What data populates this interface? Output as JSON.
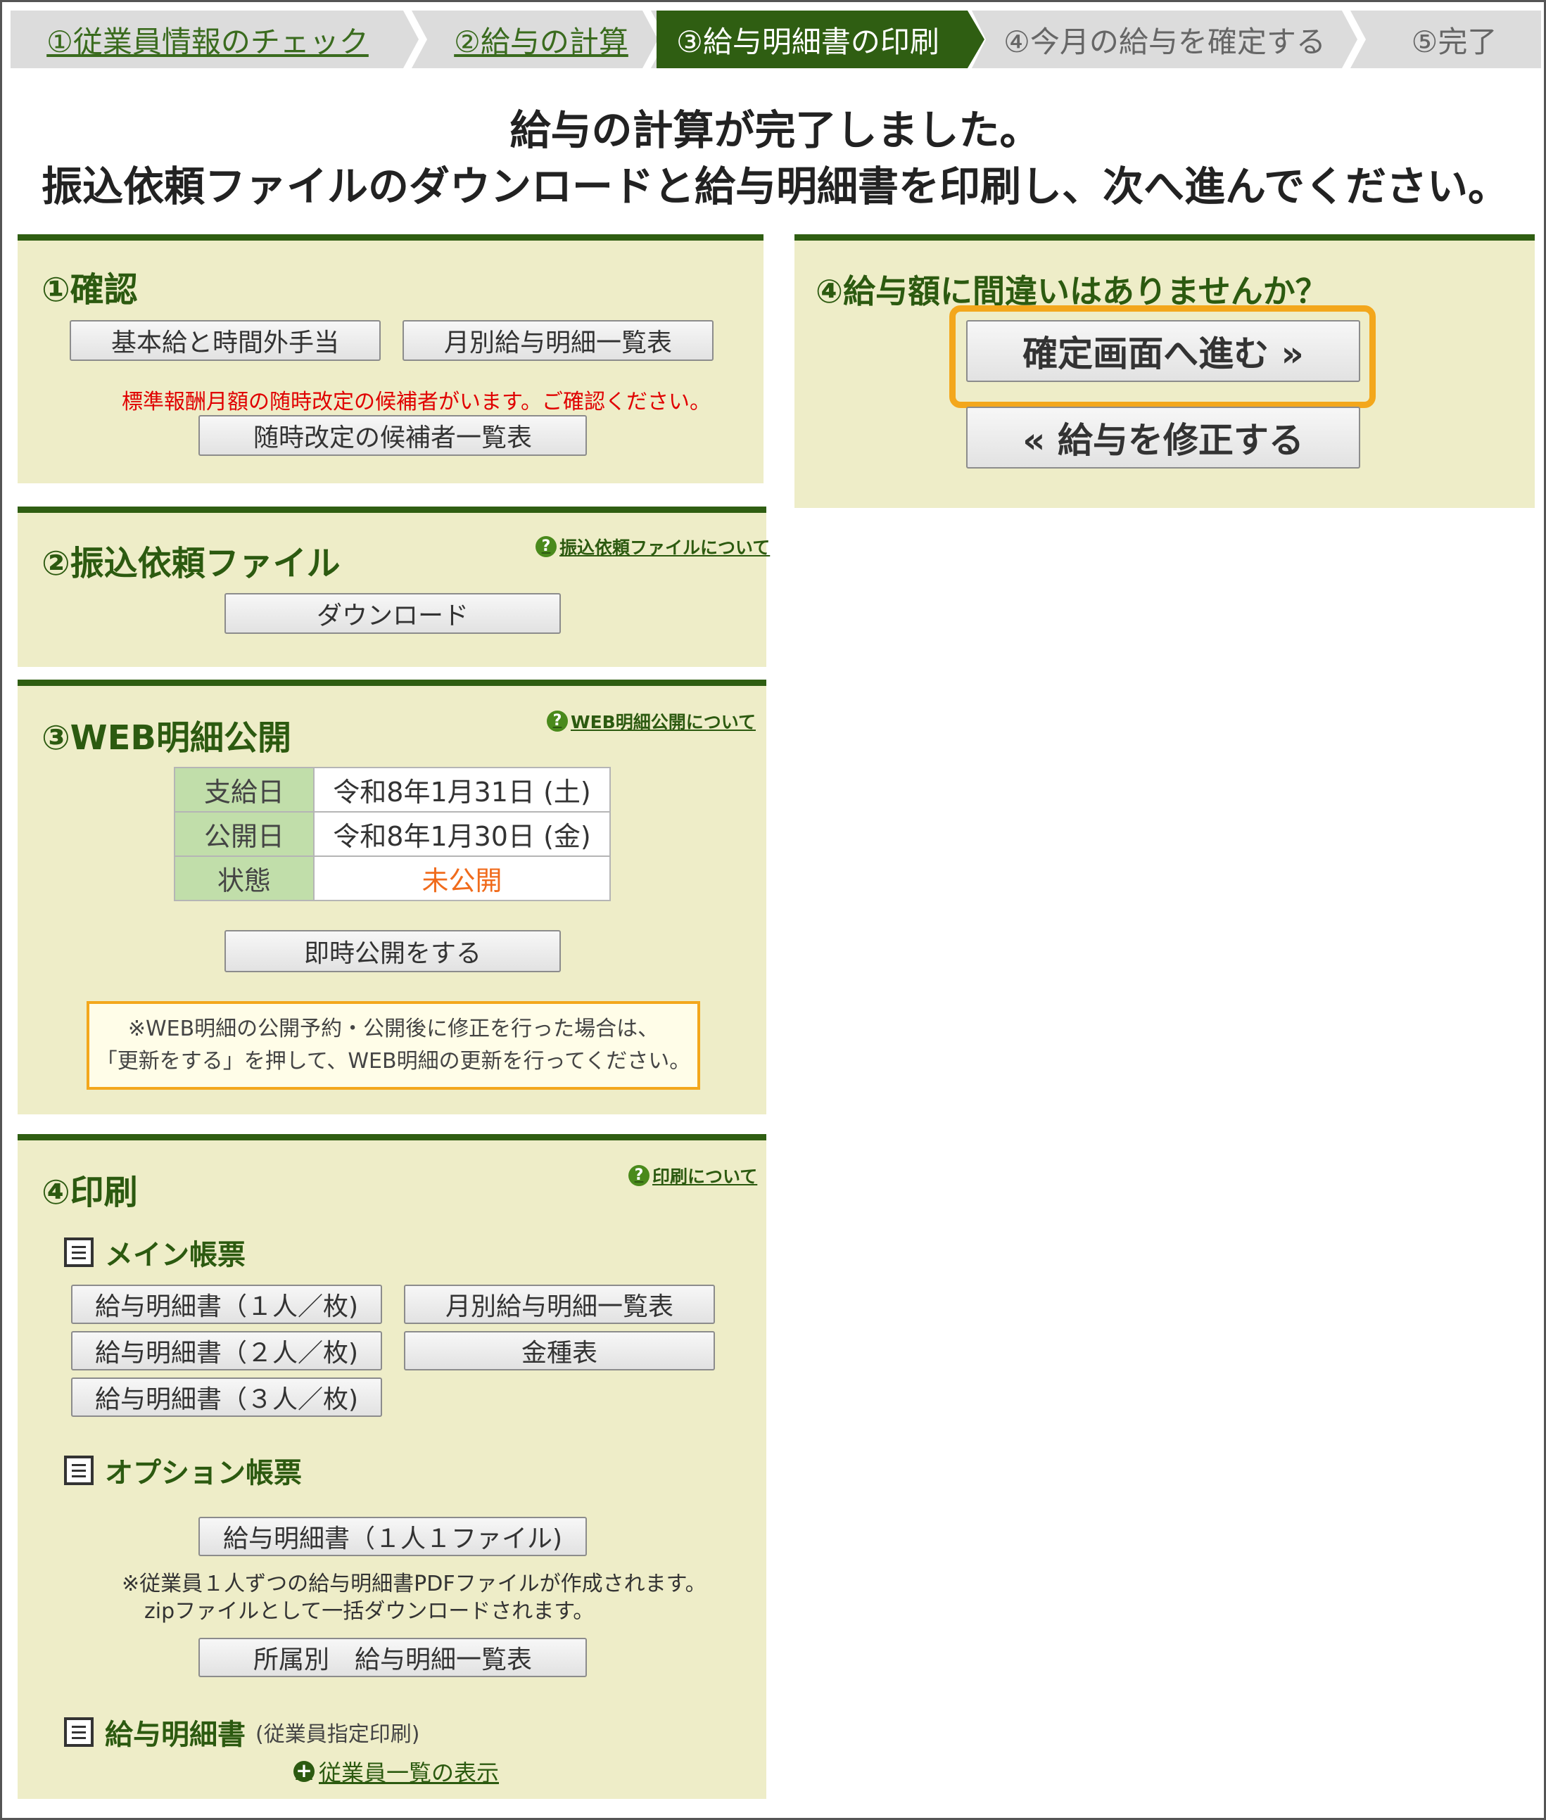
{
  "steps": [
    {
      "label": "①従業員情報のチェック",
      "state": "done"
    },
    {
      "label": "②給与の計算",
      "state": "done"
    },
    {
      "label": "③給与明細書の印刷",
      "state": "active"
    },
    {
      "label": "④今月の給与を確定する",
      "state": "future"
    },
    {
      "label": "⑤完了",
      "state": "future"
    }
  ],
  "heading": {
    "line1": "給与の計算が完了しました。",
    "line2": "振込依頼ファイルのダウンロードと給与明細書を印刷し、次へ進んでください。"
  },
  "confirm": {
    "title": "①確認",
    "btn_basic": "基本給と時間外手当",
    "btn_monthly": "月別給与明細一覧表",
    "warning": "標準報酬月額の随時改定の候補者がいます。ご確認ください。",
    "btn_candidates": "随時改定の候補者一覧表"
  },
  "transfer": {
    "title": "②振込依頼ファイル",
    "help": "振込依頼ファイルについて",
    "btn_download": "ダウンロード"
  },
  "web": {
    "title": "③WEB明細公開",
    "help": "WEB明細公開について",
    "rows": [
      {
        "key": "支給日",
        "value": "令和8年1月31日 (土)"
      },
      {
        "key": "公開日",
        "value": "令和8年1月30日 (金)"
      },
      {
        "key": "状態",
        "value": "未公開"
      }
    ],
    "btn_publish": "即時公開をする",
    "note_line1": "※WEB明細の公開予約・公開後に修正を行った場合は、",
    "note_line2": "「更新をする」を押して、WEB明細の更新を行ってください。"
  },
  "print": {
    "title": "④印刷",
    "help": "印刷について",
    "main_title": "メイン帳票",
    "btn_slip1": "給与明細書（１人／枚)",
    "btn_monthly": "月別給与明細一覧表",
    "btn_slip2": "給与明細書（２人／枚)",
    "btn_denom": "金種表",
    "btn_slip3": "給与明細書（３人／枚)",
    "option_title": "オプション帳票",
    "btn_slip_file": "給与明細書（１人１ファイル)",
    "option_note1": "※従業員１人ずつの給与明細書PDFファイルが作成されます。",
    "option_note2": "zipファイルとして一括ダウンロードされます。",
    "btn_dept": "所属別　給与明細一覧表",
    "slip_title": "給与明細書",
    "slip_sub": "(従業員指定印刷)",
    "link_employees": "従業員一覧の表示"
  },
  "finalize": {
    "title": "④給与額に間違いはありませんか？",
    "btn_confirm": "確定画面へ進む »",
    "btn_fix": "« 給与を修正する"
  },
  "colors": {
    "green_dark": "#2f5e12",
    "panel_bg": "#eeedc8",
    "highlight": "#f3a71c",
    "warning_red": "#e00000",
    "status_orange": "#f06b1c"
  }
}
